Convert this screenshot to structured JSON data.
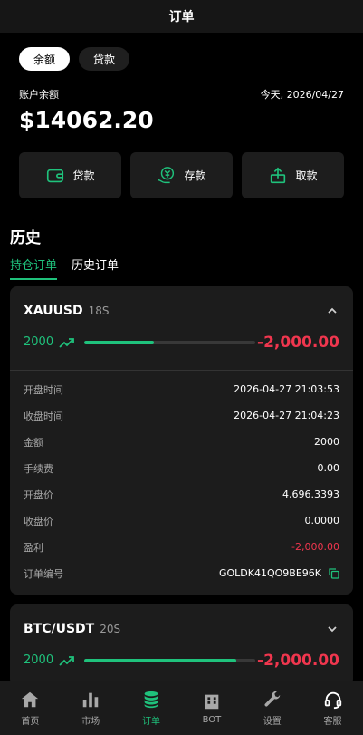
{
  "header": {
    "title": "订单"
  },
  "segments": {
    "balance": "余额",
    "loan": "贷款"
  },
  "balance": {
    "label": "账户余额",
    "date": "今天, 2026/04/27",
    "amount": "$14062.20"
  },
  "actions": [
    {
      "label": "贷款",
      "icon": "wallet-icon"
    },
    {
      "label": "存款",
      "icon": "deposit-icon"
    },
    {
      "label": "取款",
      "icon": "withdraw-icon"
    }
  ],
  "history": {
    "title": "历史",
    "tab_open": "持仓订单",
    "tab_history": "历史订单"
  },
  "orders": [
    {
      "symbol": "XAUUSD",
      "duration": "18S",
      "stake": "2000",
      "pnl": "-2,000.00",
      "progress": 0.41,
      "details": {
        "open_time_label": "开盘时间",
        "open_time": "2026-04-27 21:03:53",
        "close_time_label": "收盘时间",
        "close_time": "2026-04-27 21:04:23",
        "amount_label": "金额",
        "amount": "2000",
        "fee_label": "手续费",
        "fee": "0.00",
        "open_price_label": "开盘价",
        "open_price": "4,696.3393",
        "close_price_label": "收盘价",
        "close_price": "0.0000",
        "profit_label": "盈利",
        "profit": "-2,000.00",
        "order_no_label": "订单编号",
        "order_no": "GOLDK41QO9BE96K"
      }
    },
    {
      "symbol": "BTC/USDT",
      "duration": "20S",
      "stake": "2000",
      "pnl": "-2,000.00",
      "progress": 0.89
    }
  ],
  "nav": {
    "home": "首页",
    "market": "市场",
    "orders": "订单",
    "bot": "BOT",
    "settings": "设置",
    "support": "客服"
  },
  "colors": {
    "accent": "#1fc27c",
    "loss": "#f0364e",
    "card": "#1c1c1c"
  }
}
